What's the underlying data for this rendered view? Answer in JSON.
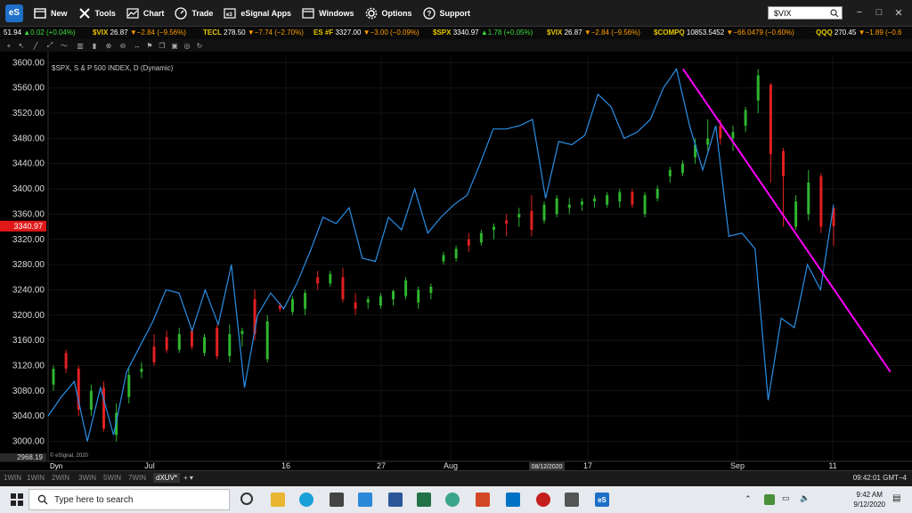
{
  "menubar": {
    "logo": "eS",
    "items": [
      {
        "label": "New",
        "icon": "new-window-icon"
      },
      {
        "label": "Tools",
        "icon": "tools-icon"
      },
      {
        "label": "Chart",
        "icon": "chart-icon"
      },
      {
        "label": "Trade",
        "icon": "trade-gauge-icon"
      },
      {
        "label": "eSignal Apps",
        "icon": "apps-icon"
      },
      {
        "label": "Windows",
        "icon": "windows-icon"
      },
      {
        "label": "Options",
        "icon": "gear-icon"
      },
      {
        "label": "Support",
        "icon": "help-icon"
      }
    ],
    "search_value": "$VIX",
    "win_controls": [
      "−",
      "□",
      "✕"
    ]
  },
  "ticker": [
    {
      "sym": "",
      "px": "51.94",
      "dir": "up",
      "chg": "▲0.02 (+0.04%)"
    },
    {
      "sym": "$VIX",
      "px": "26.87",
      "dir": "dn",
      "chg": "▼−2.84 (−9.56%)"
    },
    {
      "sym": "TECL",
      "px": "278.50",
      "dir": "dn",
      "chg": "▼−7.74 (−2.70%)"
    },
    {
      "sym": "ES #F",
      "px": "3327.00",
      "dir": "dn",
      "chg": "▼−3.00 (−0.09%)"
    },
    {
      "sym": "$SPX",
      "px": "3340.97",
      "dir": "up",
      "chg": "▲1.78 (+0.05%)"
    },
    {
      "sym": "$VIX",
      "px": "26.87",
      "dir": "dn",
      "chg": "▼−2.84 (−9.56%)"
    },
    {
      "sym": "$COMPQ",
      "px": "10853.5452",
      "dir": "dn",
      "chg": "▼−66.0479 (−0.60%)"
    },
    {
      "sym": "QQQ",
      "px": "270.45",
      "dir": "dn",
      "chg": "▼−1.89 (−0.6"
    }
  ],
  "chart": {
    "title": "$SPX, S & P 500 INDEX, D (Dynamic)",
    "watermark": "© eSignal, 2020",
    "last_price_label": "3340.97",
    "bottom_left_value": "2968.19",
    "dyn_label": "Dyn",
    "cursor_date": "08/12/2020",
    "x_labels": [
      {
        "text": "Jul",
        "x": 168
      },
      {
        "text": "16",
        "x": 321
      },
      {
        "text": "27",
        "x": 428
      },
      {
        "text": "Aug",
        "x": 506
      },
      {
        "text": "17",
        "x": 660
      },
      {
        "text": "Sep",
        "x": 828
      },
      {
        "text": "11",
        "x": 935
      }
    ]
  },
  "chart_data": {
    "type": "candlestick",
    "title": "$SPX, S & P 500 INDEX, D (Dynamic)",
    "ylim": [
      2968.19,
      3609
    ],
    "y_ticks": [
      3000,
      3040,
      3080,
      3120,
      3160,
      3200,
      3240,
      3280,
      3320,
      3360,
      3400,
      3440,
      3480,
      3520,
      3560,
      3600
    ],
    "candles": [
      {
        "o": 3090,
        "h": 3120,
        "l": 3080,
        "c": 3115
      },
      {
        "o": 3140,
        "h": 3145,
        "l": 3108,
        "c": 3115
      },
      {
        "o": 3115,
        "h": 3120,
        "l": 3040,
        "c": 3050
      },
      {
        "o": 3050,
        "h": 3090,
        "l": 3040,
        "c": 3080
      },
      {
        "o": 3085,
        "h": 3095,
        "l": 3015,
        "c": 3020
      },
      {
        "o": 3010,
        "h": 3060,
        "l": 3000,
        "c": 3045
      },
      {
        "o": 3070,
        "h": 3115,
        "l": 3060,
        "c": 3105
      },
      {
        "o": 3110,
        "h": 3125,
        "l": 3100,
        "c": 3115
      },
      {
        "o": 3150,
        "h": 3170,
        "l": 3120,
        "c": 3125
      },
      {
        "o": 3165,
        "h": 3175,
        "l": 3140,
        "c": 3145
      },
      {
        "o": 3145,
        "h": 3180,
        "l": 3140,
        "c": 3170
      },
      {
        "o": 3175,
        "h": 3180,
        "l": 3145,
        "c": 3150
      },
      {
        "o": 3140,
        "h": 3170,
        "l": 3135,
        "c": 3165
      },
      {
        "o": 3180,
        "h": 3185,
        "l": 3130,
        "c": 3135
      },
      {
        "o": 3135,
        "h": 3185,
        "l": 3125,
        "c": 3170
      },
      {
        "o": 3170,
        "h": 3180,
        "l": 3150,
        "c": 3175
      },
      {
        "o": 3225,
        "h": 3240,
        "l": 3160,
        "c": 3170
      },
      {
        "o": 3130,
        "h": 3200,
        "l": 3125,
        "c": 3190
      },
      {
        "o": 3215,
        "h": 3220,
        "l": 3205,
        "c": 3210
      },
      {
        "o": 3205,
        "h": 3230,
        "l": 3200,
        "c": 3225
      },
      {
        "o": 3210,
        "h": 3240,
        "l": 3200,
        "c": 3235
      },
      {
        "o": 3260,
        "h": 3270,
        "l": 3240,
        "c": 3250
      },
      {
        "o": 3250,
        "h": 3270,
        "l": 3245,
        "c": 3265
      },
      {
        "o": 3260,
        "h": 3275,
        "l": 3220,
        "c": 3225
      },
      {
        "o": 3220,
        "h": 3235,
        "l": 3200,
        "c": 3210
      },
      {
        "o": 3220,
        "h": 3230,
        "l": 3210,
        "c": 3225
      },
      {
        "o": 3215,
        "h": 3235,
        "l": 3210,
        "c": 3230
      },
      {
        "o": 3225,
        "h": 3240,
        "l": 3215,
        "c": 3238
      },
      {
        "o": 3230,
        "h": 3260,
        "l": 3225,
        "c": 3255
      },
      {
        "o": 3220,
        "h": 3245,
        "l": 3210,
        "c": 3240
      },
      {
        "o": 3235,
        "h": 3250,
        "l": 3225,
        "c": 3245
      },
      {
        "o": 3285,
        "h": 3300,
        "l": 3280,
        "c": 3295
      },
      {
        "o": 3290,
        "h": 3310,
        "l": 3285,
        "c": 3305
      },
      {
        "o": 3320,
        "h": 3330,
        "l": 3300,
        "c": 3310
      },
      {
        "o": 3315,
        "h": 3335,
        "l": 3310,
        "c": 3330
      },
      {
        "o": 3335,
        "h": 3345,
        "l": 3320,
        "c": 3340
      },
      {
        "o": 3350,
        "h": 3360,
        "l": 3325,
        "c": 3345
      },
      {
        "o": 3355,
        "h": 3370,
        "l": 3340,
        "c": 3360
      },
      {
        "o": 3365,
        "h": 3390,
        "l": 3325,
        "c": 3335
      },
      {
        "o": 3350,
        "h": 3380,
        "l": 3345,
        "c": 3375
      },
      {
        "o": 3360,
        "h": 3390,
        "l": 3355,
        "c": 3385
      },
      {
        "o": 3370,
        "h": 3385,
        "l": 3360,
        "c": 3375
      },
      {
        "o": 3375,
        "h": 3385,
        "l": 3365,
        "c": 3380
      },
      {
        "o": 3380,
        "h": 3390,
        "l": 3370,
        "c": 3385
      },
      {
        "o": 3375,
        "h": 3395,
        "l": 3370,
        "c": 3390
      },
      {
        "o": 3380,
        "h": 3400,
        "l": 3370,
        "c": 3395
      },
      {
        "o": 3395,
        "h": 3400,
        "l": 3370,
        "c": 3375
      },
      {
        "o": 3360,
        "h": 3395,
        "l": 3355,
        "c": 3390
      },
      {
        "o": 3385,
        "h": 3405,
        "l": 3380,
        "c": 3400
      },
      {
        "o": 3420,
        "h": 3435,
        "l": 3410,
        "c": 3430
      },
      {
        "o": 3425,
        "h": 3445,
        "l": 3420,
        "c": 3440
      },
      {
        "o": 3450,
        "h": 3480,
        "l": 3440,
        "c": 3470
      },
      {
        "o": 3470,
        "h": 3510,
        "l": 3460,
        "c": 3480
      },
      {
        "o": 3500,
        "h": 3510,
        "l": 3470,
        "c": 3480
      },
      {
        "o": 3480,
        "h": 3500,
        "l": 3460,
        "c": 3490
      },
      {
        "o": 3500,
        "h": 3530,
        "l": 3490,
        "c": 3525
      },
      {
        "o": 3540,
        "h": 3590,
        "l": 3520,
        "c": 3580
      },
      {
        "o": 3565,
        "h": 3568,
        "l": 3410,
        "c": 3455
      },
      {
        "o": 3460,
        "h": 3465,
        "l": 3340,
        "c": 3420
      },
      {
        "o": 3340,
        "h": 3390,
        "l": 3335,
        "c": 3380
      },
      {
        "o": 3360,
        "h": 3430,
        "l": 3350,
        "c": 3410
      },
      {
        "o": 3420,
        "h": 3425,
        "l": 3330,
        "c": 3340
      },
      {
        "o": 3370,
        "h": 3370,
        "l": 3310,
        "c": 3341
      }
    ],
    "overlay_line": {
      "name": "$VIX",
      "color": "#2a8fe6",
      "values": [
        3040,
        3070,
        3095,
        3000,
        3085,
        3010,
        3110,
        3150,
        3190,
        3240,
        3235,
        3175,
        3240,
        3185,
        3280,
        3085,
        3200,
        3235,
        3210,
        3250,
        3300,
        3355,
        3345,
        3370,
        3290,
        3285,
        3355,
        3335,
        3400,
        3330,
        3355,
        3375,
        3390,
        3440,
        3495,
        3495,
        3500,
        3510,
        3385,
        3475,
        3470,
        3485,
        3550,
        3530,
        3480,
        3490,
        3510,
        3560,
        3590,
        3500,
        3430,
        3500,
        3325,
        3330,
        3305,
        3065,
        3195,
        3180,
        3280,
        3240,
        3375
      ]
    },
    "trendline": {
      "color": "#ff00ff",
      "from": [
        0.735,
        3590
      ],
      "to": [
        0.975,
        3110
      ]
    }
  },
  "pagebar": {
    "tabs": [
      "1WIN",
      "1WIN",
      "2WIN",
      "3WIN",
      "5WIN",
      "7WIN",
      "dXUV*"
    ],
    "active_index": 6,
    "time": "09:42:01 GMT−4"
  },
  "taskbar": {
    "search_placeholder": "Type here to search",
    "time": "9:42 AM",
    "date": "9/12/2020"
  }
}
